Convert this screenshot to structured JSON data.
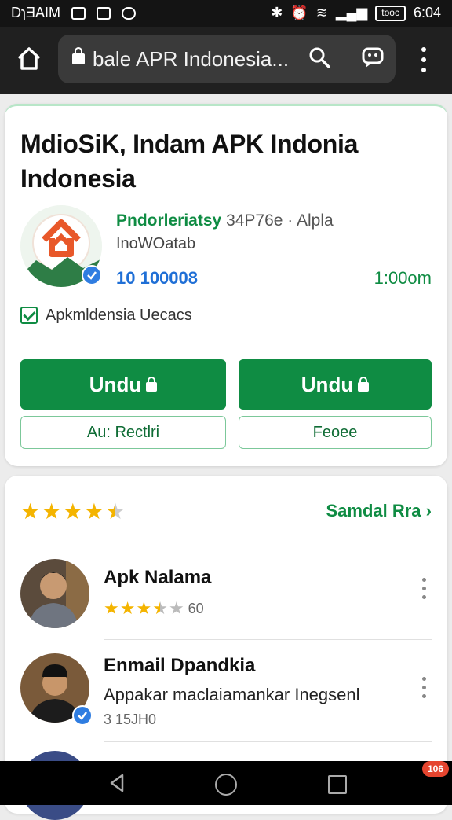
{
  "status_bar": {
    "carrier": "DɿƎAIM",
    "battery_label": "tooc",
    "time": "6:04"
  },
  "browser": {
    "url": "bale APR Indonesia...",
    "icons": [
      "home-icon",
      "lock-icon",
      "search-icon",
      "chat-icon",
      "more-vert-icon"
    ]
  },
  "app": {
    "title": "MdioSiK, Indam APK Indonia Indonesia",
    "developer": "Pndorleriatsy",
    "developer_meta": "34P76e · Alpla",
    "subtitle": "InoWOatab",
    "downloads": "10 100008",
    "size": "1:00om",
    "checkbox_label": "Apkmldensia Uecacs",
    "primary_buttons": [
      {
        "label": "Undu"
      },
      {
        "label": "Undu"
      }
    ],
    "secondary_buttons": [
      {
        "label": "Au: Rectlri"
      },
      {
        "label": "Feoee"
      }
    ]
  },
  "reviews": {
    "rating": 4.5,
    "see_all_label": "Samdal Rra",
    "items": [
      {
        "name": "Apk Nalama",
        "rating": 3.5,
        "rating_text": "60",
        "text": "",
        "meta": ""
      },
      {
        "name": "Enmail Dpandkia",
        "rating": 0,
        "rating_text": "",
        "text": "Appakar maclaiamankar Inegsenl",
        "meta": "3 15JH0"
      }
    ]
  },
  "colors": {
    "accent": "#0f8c43",
    "link_blue": "#1f6fd6",
    "star": "#f4b400"
  }
}
